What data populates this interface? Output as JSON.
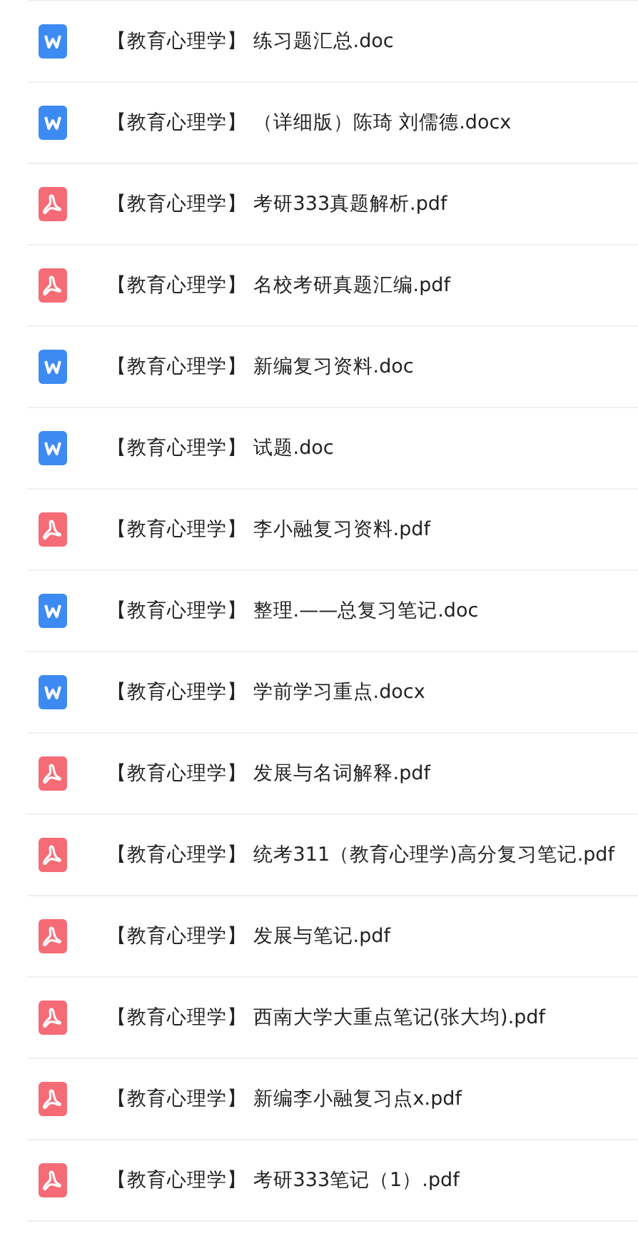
{
  "files": [
    {
      "kind": "word",
      "name": "【教育心理学】 练习题汇总.doc"
    },
    {
      "kind": "word",
      "name": "【教育心理学】 （详细版）陈琦 刘儒德.docx"
    },
    {
      "kind": "pdf",
      "name": "【教育心理学】 考研333真题解析.pdf"
    },
    {
      "kind": "pdf",
      "name": "【教育心理学】 名校考研真题汇编.pdf"
    },
    {
      "kind": "word",
      "name": "【教育心理学】 新编复习资料.doc"
    },
    {
      "kind": "word",
      "name": "【教育心理学】 试题.doc"
    },
    {
      "kind": "pdf",
      "name": "【教育心理学】 李小融复习资料.pdf"
    },
    {
      "kind": "word",
      "name": "【教育心理学】 整理.——总复习笔记.doc"
    },
    {
      "kind": "word",
      "name": "【教育心理学】 学前学习重点.docx"
    },
    {
      "kind": "pdf",
      "name": "【教育心理学】 发展与名词解释.pdf"
    },
    {
      "kind": "pdf",
      "name": "【教育心理学】 统考311（教育心理学)高分复习笔记.pdf"
    },
    {
      "kind": "pdf",
      "name": "【教育心理学】 发展与笔记.pdf"
    },
    {
      "kind": "pdf",
      "name": "【教育心理学】 西南大学大重点笔记(张大均).pdf"
    },
    {
      "kind": "pdf",
      "name": "【教育心理学】 新编李小融复习点x.pdf"
    },
    {
      "kind": "pdf",
      "name": "【教育心理学】 考研333笔记（1）.pdf"
    }
  ]
}
